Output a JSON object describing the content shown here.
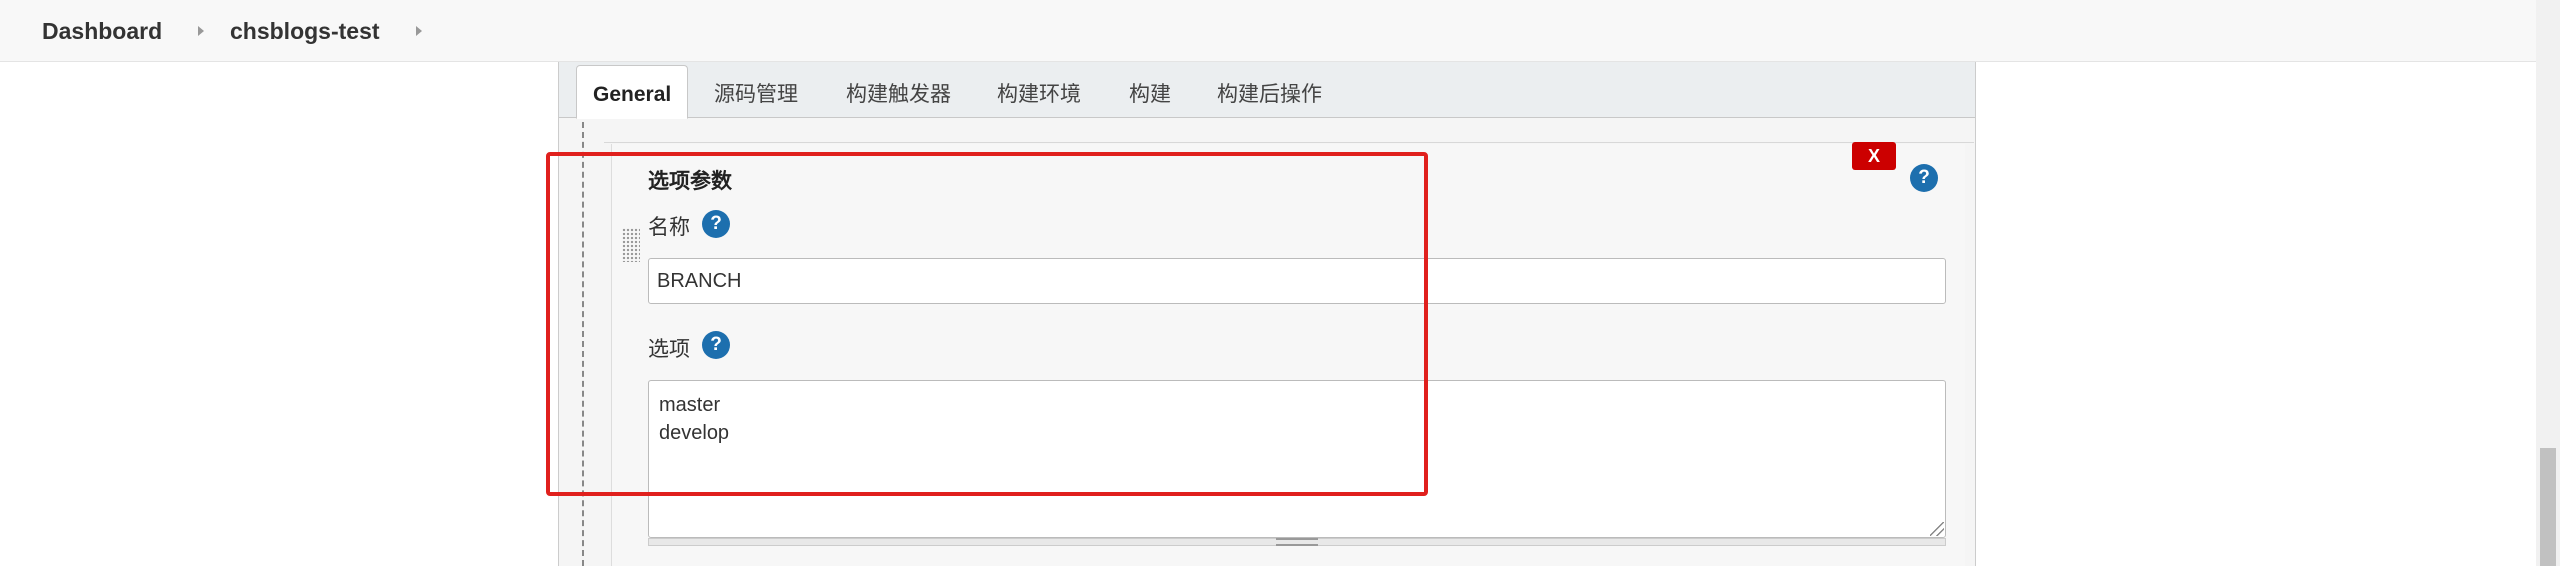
{
  "breadcrumb": {
    "items": [
      "Dashboard",
      "chsblogs-test"
    ]
  },
  "tabs": [
    {
      "label": "General",
      "active": true
    },
    {
      "label": "源码管理",
      "active": false
    },
    {
      "label": "构建触发器",
      "active": false
    },
    {
      "label": "构建环境",
      "active": false
    },
    {
      "label": "构建",
      "active": false
    },
    {
      "label": "构建后操作",
      "active": false
    }
  ],
  "parameter": {
    "title": "选项参数",
    "delete_label": "X",
    "help_symbol": "?",
    "name_label": "名称",
    "name_value": "BRANCH",
    "choices_label": "选项",
    "choices": [
      "master",
      "develop"
    ]
  },
  "colors": {
    "highlight": "#e0201d",
    "help_icon": "#1d6fae",
    "delete_button": "#cc0000"
  }
}
